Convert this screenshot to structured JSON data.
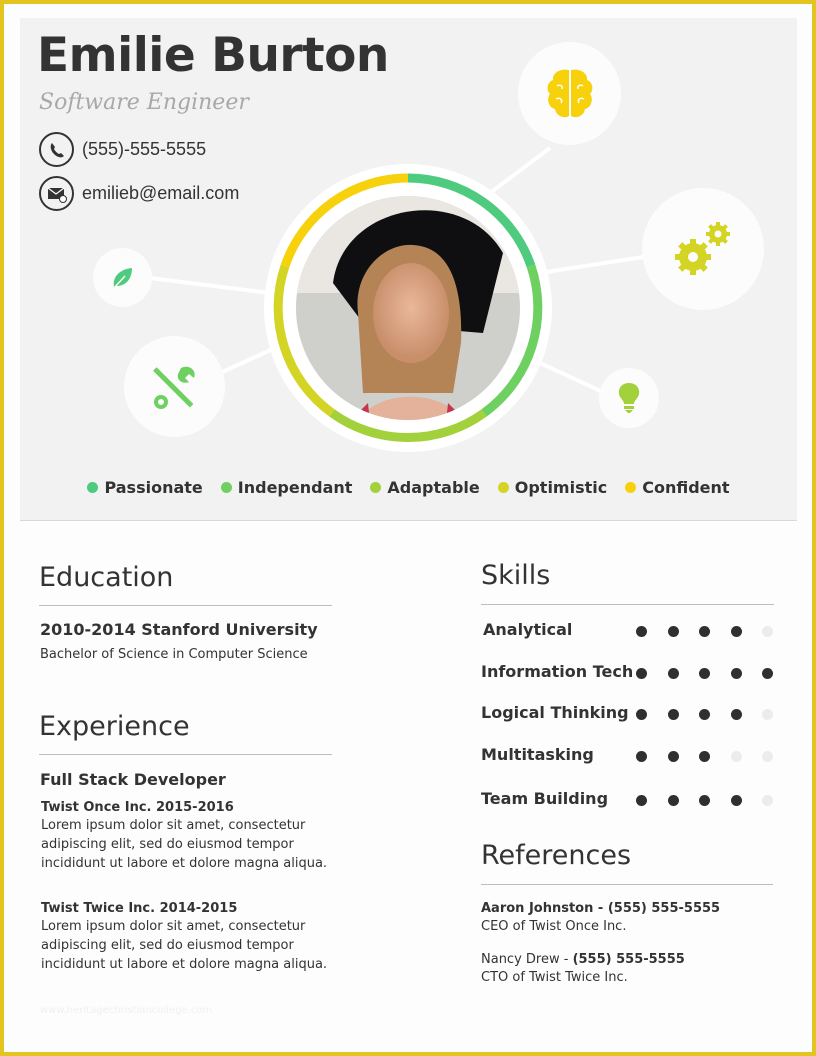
{
  "header": {
    "name": "Emilie Burton",
    "title": "Software Engineer",
    "phone": "(555)-555-5555",
    "email": "emilieb@email.com",
    "icons": [
      "brain-icon",
      "gears-icon",
      "leaf-icon",
      "tools-icon",
      "lightbulb-icon"
    ],
    "traits": [
      {
        "label": "Passionate",
        "color": "#4ecb7e"
      },
      {
        "label": "Independant",
        "color": "#6fd062"
      },
      {
        "label": "Adaptable",
        "color": "#a2d13c"
      },
      {
        "label": "Optimistic",
        "color": "#d4d424"
      },
      {
        "label": "Confident",
        "color": "#f7d10c"
      }
    ]
  },
  "education": {
    "heading": "Education",
    "entry_title": "2010-2014 Stanford University",
    "entry_detail": "Bachelor of Science in Computer Science"
  },
  "experience": {
    "heading": "Experience",
    "role": "Full Stack Developer",
    "jobs": [
      {
        "company": "Twist Once Inc. 2015-2016",
        "lines": [
          "Lorem ipsum dolor sit amet, consectetur",
          "adipiscing elit, sed do eiusmod tempor",
          "incididunt ut labore et dolore magna aliqua."
        ]
      },
      {
        "company": "Twist Twice Inc. 2014-2015",
        "lines": [
          "Lorem ipsum dolor sit amet, consectetur",
          "adipiscing elit, sed do eiusmod tempor",
          "incididunt ut labore et dolore magna aliqua."
        ]
      }
    ]
  },
  "skills": {
    "heading": "Skills",
    "max": 5,
    "items": [
      {
        "label": "Analytical",
        "rating": 4
      },
      {
        "label": "Information Tech",
        "rating": 5
      },
      {
        "label": "Logical Thinking",
        "rating": 4
      },
      {
        "label": "Multitasking",
        "rating": 3
      },
      {
        "label": "Team Building",
        "rating": 4
      }
    ]
  },
  "references": {
    "heading": "References",
    "items": [
      {
        "name": "Aaron Johnston - ",
        "phone": "(555) 555-5555",
        "role": "CEO of Twist Once Inc."
      },
      {
        "name": "Nancy Drew - ",
        "phone": "(555) 555-5555",
        "role": "CTO of Twist Twice Inc."
      }
    ]
  },
  "watermark": "www.heritagechristiancollege.com"
}
